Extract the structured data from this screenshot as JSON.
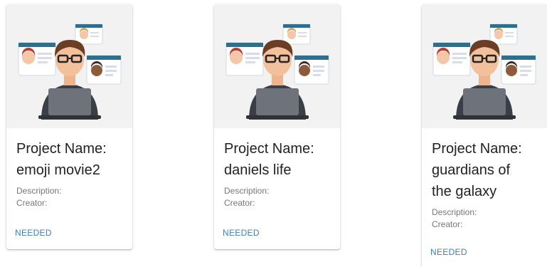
{
  "cards": [
    {
      "title_line1": "Project Name:",
      "title_line2": "emoji movie2",
      "description_label": "Description:",
      "creator_label": "Creator:",
      "action_label": "NEEDED"
    },
    {
      "title_line1": "Project Name:",
      "title_line2": "daniels life",
      "description_label": "Description:",
      "creator_label": "Creator:",
      "action_label": "NEEDED"
    },
    {
      "title_line1": "Project Name:",
      "title_line2": "guardians of",
      "title_line3": "the galaxy",
      "description_label": "Description:",
      "creator_label": "Creator:",
      "action_label": "NEEDED"
    }
  ],
  "colors": {
    "accent": "#3f7fb8",
    "media_bg": "#f2f2f2"
  },
  "icons": {
    "card_media": "person-at-laptop-illustration"
  }
}
